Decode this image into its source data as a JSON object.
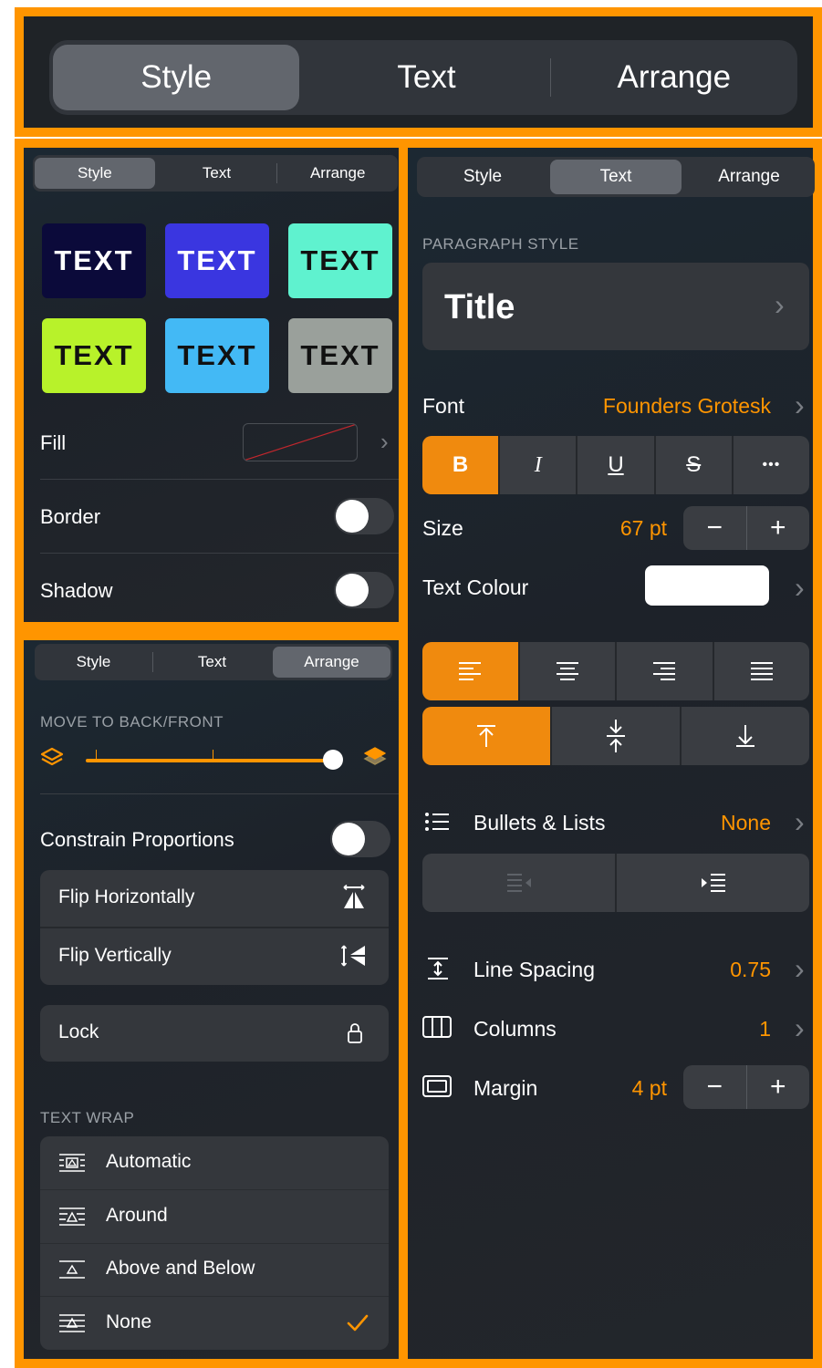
{
  "top": {
    "tabs": [
      "Style",
      "Text",
      "Arrange"
    ],
    "selected": 0
  },
  "style_panel": {
    "tabs": [
      "Style",
      "Text",
      "Arrange"
    ],
    "tiles": [
      {
        "label": "TEXT",
        "bg": "#0b0a3a",
        "fg": "#ffffff"
      },
      {
        "label": "TEXT",
        "bg": "#3a36e0",
        "fg": "#ffffff"
      },
      {
        "label": "TEXT",
        "bg": "#5ff2cf",
        "fg": "#111111"
      },
      {
        "label": "TEXT",
        "bg": "#b8f22a",
        "fg": "#111111"
      },
      {
        "label": "TEXT",
        "bg": "#43b9f5",
        "fg": "#111111"
      },
      {
        "label": "TEXT",
        "bg": "#9aa09b",
        "fg": "#111111"
      }
    ],
    "fill_label": "Fill",
    "border_label": "Border",
    "shadow_label": "Shadow"
  },
  "arrange_panel": {
    "tabs": [
      "Style",
      "Text",
      "Arrange"
    ],
    "move_header": "MOVE TO BACK/FRONT",
    "layer_slider": 1.0,
    "constrain_label": "Constrain Proportions",
    "flip_h": "Flip Horizontally",
    "flip_v": "Flip Vertically",
    "lock": "Lock",
    "text_wrap_header": "TEXT WRAP",
    "wrap_options": [
      "Automatic",
      "Around",
      "Above and Below",
      "None"
    ],
    "wrap_selected": "None"
  },
  "text_panel": {
    "tabs": [
      "Style",
      "Text",
      "Arrange"
    ],
    "paragraph_header": "PARAGRAPH STYLE",
    "paragraph_value": "Title",
    "font_label": "Font",
    "font_value": "Founders Grotesk",
    "format_buttons": [
      "B",
      "I",
      "U",
      "S",
      "•••"
    ],
    "size_label": "Size",
    "size_value": "67 pt",
    "colour_label": "Text Colour",
    "bullets_label": "Bullets & Lists",
    "bullets_value": "None",
    "line_spacing_label": "Line Spacing",
    "line_spacing_value": "0.75",
    "columns_label": "Columns",
    "columns_value": "1",
    "margin_label": "Margin",
    "margin_value": "4 pt",
    "minus": "−",
    "plus": "+"
  },
  "colors": {
    "accent": "#ff9500",
    "frame": "#ff9500",
    "text_colour_swatch": "#ffffff"
  }
}
